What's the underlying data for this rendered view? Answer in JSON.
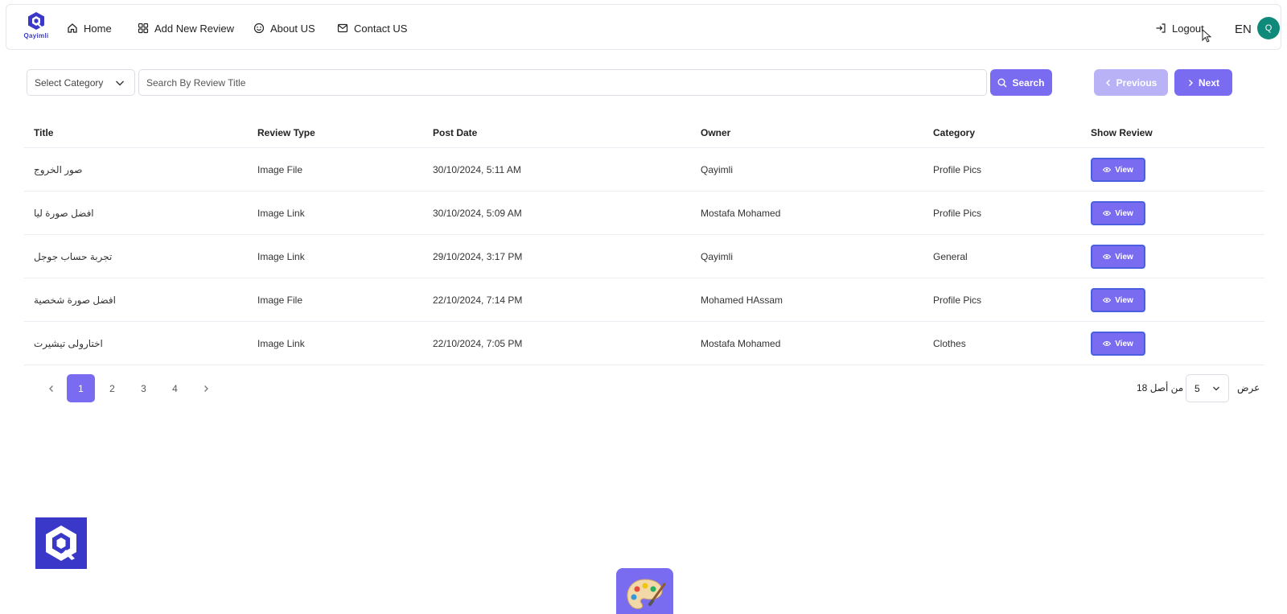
{
  "brand": {
    "name": "Qayimli"
  },
  "nav": {
    "home": "Home",
    "add_review": "Add New Review",
    "about": "About US",
    "contact": "Contact US",
    "logout": "Logout",
    "language": "EN",
    "avatar_letter": "Q"
  },
  "toolbar": {
    "category_placeholder": "Select Category",
    "search_placeholder": "Search By Review Title",
    "search_label": "Search",
    "previous_label": "Previous",
    "next_label": "Next"
  },
  "table": {
    "headers": [
      "Title",
      "Review Type",
      "Post Date",
      "Owner",
      "Category",
      "Show Review"
    ],
    "view_label": "View",
    "rows": [
      {
        "title": "صور الخروج",
        "type": "Image File",
        "date": "30/10/2024, 5:11 AM",
        "owner": "Qayimli",
        "category": "Profile Pics"
      },
      {
        "title": "افضل صورة ليا",
        "type": "Image Link",
        "date": "30/10/2024, 5:09 AM",
        "owner": "Mostafa Mohamed",
        "category": "Profile Pics"
      },
      {
        "title": "تجربة حساب جوجل",
        "type": "Image Link",
        "date": "29/10/2024, 3:17 PM",
        "owner": "Qayimli",
        "category": "General"
      },
      {
        "title": "افضل صورة شخصية",
        "type": "Image File",
        "date": "22/10/2024, 7:14 PM",
        "owner": "Mohamed HAssam",
        "category": "Profile Pics"
      },
      {
        "title": "اختارولى تيشيرت",
        "type": "Image Link",
        "date": "22/10/2024, 7:05 PM",
        "owner": "Mostafa Mohamed",
        "category": "Clothes"
      }
    ]
  },
  "pagination": {
    "pages": [
      "1",
      "2",
      "3",
      "4"
    ],
    "current": "1",
    "page_size": "5",
    "of_total": "من أصل 18",
    "show_label": "عرض"
  },
  "icons": {
    "home": "home-icon",
    "add": "grid-icon",
    "about": "smile-icon",
    "contact": "mail-icon",
    "logout": "logout-icon",
    "search": "search-icon",
    "view": "eye-icon",
    "palette": "palette-icon"
  },
  "colors": {
    "accent": "#7a6cf0",
    "accent_disabled": "#b9b2f7",
    "brand": "#3a38c8",
    "avatar": "#0f8a7a"
  }
}
